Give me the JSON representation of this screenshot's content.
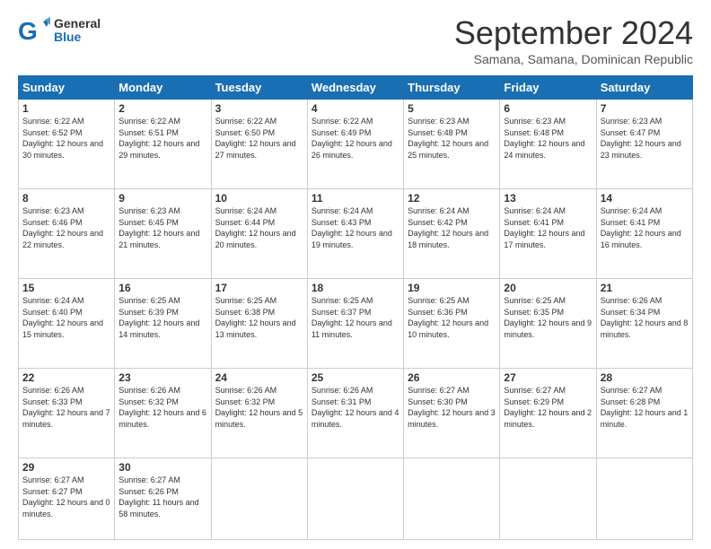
{
  "logo": {
    "line1": "General",
    "line2": "Blue"
  },
  "header": {
    "month": "September 2024",
    "location": "Samana, Samana, Dominican Republic"
  },
  "days_of_week": [
    "Sunday",
    "Monday",
    "Tuesday",
    "Wednesday",
    "Thursday",
    "Friday",
    "Saturday"
  ],
  "weeks": [
    [
      {
        "day": "1",
        "sunrise": "6:22 AM",
        "sunset": "6:52 PM",
        "daylight": "12 hours and 30 minutes."
      },
      {
        "day": "2",
        "sunrise": "6:22 AM",
        "sunset": "6:51 PM",
        "daylight": "12 hours and 29 minutes."
      },
      {
        "day": "3",
        "sunrise": "6:22 AM",
        "sunset": "6:50 PM",
        "daylight": "12 hours and 27 minutes."
      },
      {
        "day": "4",
        "sunrise": "6:22 AM",
        "sunset": "6:49 PM",
        "daylight": "12 hours and 26 minutes."
      },
      {
        "day": "5",
        "sunrise": "6:23 AM",
        "sunset": "6:48 PM",
        "daylight": "12 hours and 25 minutes."
      },
      {
        "day": "6",
        "sunrise": "6:23 AM",
        "sunset": "6:48 PM",
        "daylight": "12 hours and 24 minutes."
      },
      {
        "day": "7",
        "sunrise": "6:23 AM",
        "sunset": "6:47 PM",
        "daylight": "12 hours and 23 minutes."
      }
    ],
    [
      {
        "day": "8",
        "sunrise": "6:23 AM",
        "sunset": "6:46 PM",
        "daylight": "12 hours and 22 minutes."
      },
      {
        "day": "9",
        "sunrise": "6:23 AM",
        "sunset": "6:45 PM",
        "daylight": "12 hours and 21 minutes."
      },
      {
        "day": "10",
        "sunrise": "6:24 AM",
        "sunset": "6:44 PM",
        "daylight": "12 hours and 20 minutes."
      },
      {
        "day": "11",
        "sunrise": "6:24 AM",
        "sunset": "6:43 PM",
        "daylight": "12 hours and 19 minutes."
      },
      {
        "day": "12",
        "sunrise": "6:24 AM",
        "sunset": "6:42 PM",
        "daylight": "12 hours and 18 minutes."
      },
      {
        "day": "13",
        "sunrise": "6:24 AM",
        "sunset": "6:41 PM",
        "daylight": "12 hours and 17 minutes."
      },
      {
        "day": "14",
        "sunrise": "6:24 AM",
        "sunset": "6:41 PM",
        "daylight": "12 hours and 16 minutes."
      }
    ],
    [
      {
        "day": "15",
        "sunrise": "6:24 AM",
        "sunset": "6:40 PM",
        "daylight": "12 hours and 15 minutes."
      },
      {
        "day": "16",
        "sunrise": "6:25 AM",
        "sunset": "6:39 PM",
        "daylight": "12 hours and 14 minutes."
      },
      {
        "day": "17",
        "sunrise": "6:25 AM",
        "sunset": "6:38 PM",
        "daylight": "12 hours and 13 minutes."
      },
      {
        "day": "18",
        "sunrise": "6:25 AM",
        "sunset": "6:37 PM",
        "daylight": "12 hours and 11 minutes."
      },
      {
        "day": "19",
        "sunrise": "6:25 AM",
        "sunset": "6:36 PM",
        "daylight": "12 hours and 10 minutes."
      },
      {
        "day": "20",
        "sunrise": "6:25 AM",
        "sunset": "6:35 PM",
        "daylight": "12 hours and 9 minutes."
      },
      {
        "day": "21",
        "sunrise": "6:26 AM",
        "sunset": "6:34 PM",
        "daylight": "12 hours and 8 minutes."
      }
    ],
    [
      {
        "day": "22",
        "sunrise": "6:26 AM",
        "sunset": "6:33 PM",
        "daylight": "12 hours and 7 minutes."
      },
      {
        "day": "23",
        "sunrise": "6:26 AM",
        "sunset": "6:32 PM",
        "daylight": "12 hours and 6 minutes."
      },
      {
        "day": "24",
        "sunrise": "6:26 AM",
        "sunset": "6:32 PM",
        "daylight": "12 hours and 5 minutes."
      },
      {
        "day": "25",
        "sunrise": "6:26 AM",
        "sunset": "6:31 PM",
        "daylight": "12 hours and 4 minutes."
      },
      {
        "day": "26",
        "sunrise": "6:27 AM",
        "sunset": "6:30 PM",
        "daylight": "12 hours and 3 minutes."
      },
      {
        "day": "27",
        "sunrise": "6:27 AM",
        "sunset": "6:29 PM",
        "daylight": "12 hours and 2 minutes."
      },
      {
        "day": "28",
        "sunrise": "6:27 AM",
        "sunset": "6:28 PM",
        "daylight": "12 hours and 1 minute."
      }
    ],
    [
      {
        "day": "29",
        "sunrise": "6:27 AM",
        "sunset": "6:27 PM",
        "daylight": "12 hours and 0 minutes."
      },
      {
        "day": "30",
        "sunrise": "6:27 AM",
        "sunset": "6:26 PM",
        "daylight": "11 hours and 58 minutes."
      },
      null,
      null,
      null,
      null,
      null
    ]
  ]
}
